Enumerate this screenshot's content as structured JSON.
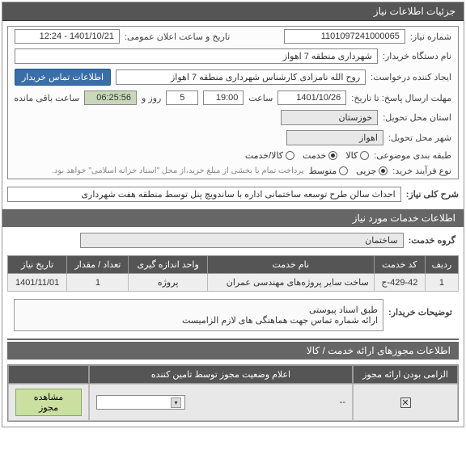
{
  "header": {
    "title": "جزئیات اطلاعات نیاز"
  },
  "info": {
    "need_no_label": "شماره نیاز:",
    "need_no": "1101097241000065",
    "pub_date_label": "تاریخ و ساعت اعلان عمومی:",
    "pub_date": "1401/10/21 - 12:24",
    "buyer_label": "نام دستگاه خریدار:",
    "buyer": "شهرداری منطقه 7 اهواز",
    "creator_label": "ایجاد کننده درخواست:",
    "creator": "روح الله نامرادی کارشناس شهرداری منطقه 7 اهواز",
    "contact_btn": "اطلاعات تماس خریدار",
    "deadline_label": "مهلت ارسال پاسخ: تا تاریخ:",
    "deadline_date": "1401/10/26",
    "time_label": "ساعت",
    "deadline_time": "19:00",
    "and_label": "روز و",
    "remain_days": "5",
    "remain_time": "06:25:56",
    "remain_label": "ساعت باقی مانده",
    "province_label": "استان محل تحویل:",
    "province": "خوزستان",
    "city_label": "شهر محل تحویل:",
    "city": "اهواز",
    "category_label": "طبقه بندی موضوعی:",
    "cat_goods": "کالا",
    "cat_service": "خدمت",
    "cat_both": "کالا/خدمت",
    "process_label": "نوع فرآیند خرید:",
    "proc_minor": "جزیی",
    "proc_medium": "متوسط",
    "proc_note": "پرداخت تمام یا بخشی از مبلغ خرید،از محل \"اسناد خزانه اسلامی\" خواهد بود."
  },
  "desc": {
    "main_label": "شرح کلی نیاز:",
    "main_text": "احداث سالن طرح توسعه ساختمانی اداره با ساندویچ پنل توسط منطقه هفت شهرداری",
    "services_header": "اطلاعات خدمات مورد نیاز",
    "group_label": "گروه خدمت:",
    "group_value": "ساختمان"
  },
  "table": {
    "h_row": "ردیف",
    "h_code": "کد خدمت",
    "h_name": "نام خدمت",
    "h_unit": "واحد اندازه گیری",
    "h_qty": "تعداد / مقدار",
    "h_date": "تاریخ نیاز",
    "r_row": "1",
    "r_code": "429-42-ج",
    "r_name": "ساخت سایر پروژه‌های مهندسی عمران",
    "r_unit": "پروژه",
    "r_qty": "1",
    "r_date": "1401/11/01"
  },
  "buyer_notes": {
    "label": "توضیحات خریدار:",
    "line1": "طبق اسناد پیوستی",
    "line2": "ارائه شماره تماس جهت هماهنگی های لازم الزامیست"
  },
  "auth": {
    "header": "اطلاعات مجوزهای ارائه خدمت / کالا",
    "col_mandatory": "الزامی بودن ارائه مجوز",
    "col_status": "اعلام وضعیت مجوز توسط تامین کننده",
    "dash": "--",
    "view_btn": "مشاهده مجوز"
  }
}
